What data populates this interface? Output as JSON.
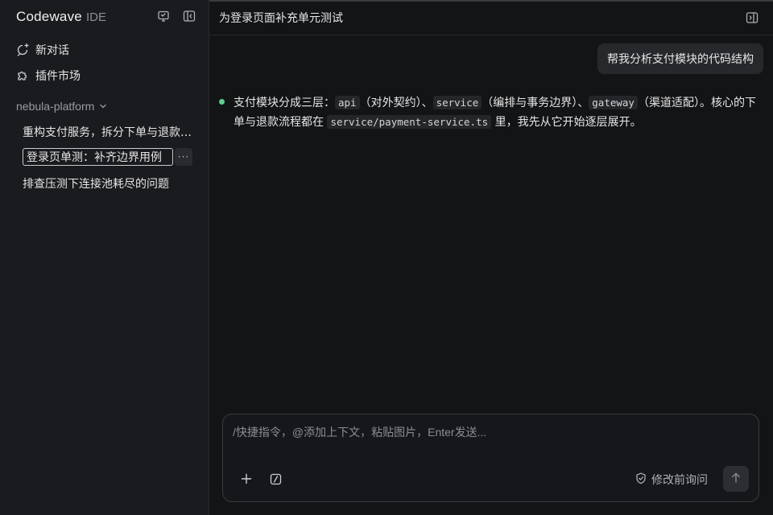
{
  "app": {
    "brand_name": "Codewave",
    "brand_suffix": "IDE",
    "accent_color": "#e0473c",
    "status_color": "#5ccf8b"
  },
  "sidebar": {
    "icons": [
      "monitor-chat-icon",
      "collapse-sidebar-icon"
    ],
    "nav": [
      {
        "label": "新对话",
        "icon": "new-chat-icon"
      },
      {
        "label": "插件市场",
        "icon": "puzzle-icon"
      }
    ],
    "group": {
      "label": "nebula-platform",
      "icon": "chevron-down-icon"
    },
    "conversations": [
      {
        "title": "重构支付服务，拆分下单与退款…"
      },
      {
        "title": "登录页单测：补齐边界用例",
        "editing": true,
        "more_label": "···"
      },
      {
        "title": "排查压测下连接池耗尽的问题"
      }
    ]
  },
  "main": {
    "title": "为登录页面补充单元测试",
    "panel_icon": "toggle-panel-icon",
    "messages": {
      "user": "帮我分析支付模块的代码结构",
      "assistant": {
        "p1": "支付模块分成三层：",
        "c1": "api",
        "p2": "（对外契约）、",
        "c2": "service",
        "p3": "（编排与事务边界）、",
        "c3": "gateway",
        "p4": "（渠道适配）。核心的下单与退款流程都在",
        "c4": "service/payment-service.ts",
        "p5": "里，我先从它开始逐层展开。"
      }
    }
  },
  "composer": {
    "placeholder": "/快捷指令，@添加上下文，粘贴图片，Enter发送...",
    "value": "",
    "add_icon": "plus-icon",
    "command_icon": "slash-command-icon",
    "confirm_label": "修改前询问",
    "confirm_icon": "shield-check-icon",
    "send_icon": "arrow-up-icon"
  }
}
